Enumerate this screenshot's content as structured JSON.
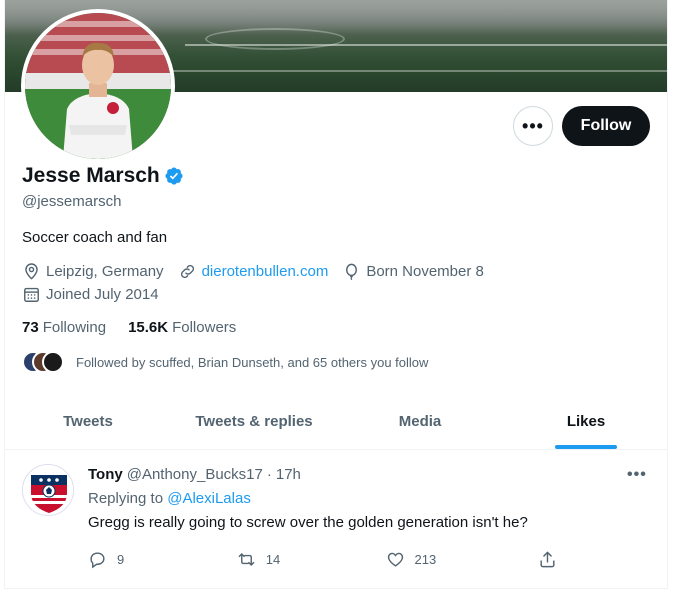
{
  "profile": {
    "name": "Jesse Marsch",
    "handle": "@jessemarsch",
    "bio": "Soccer coach and fan",
    "location": "Leipzig, Germany",
    "website": "dierotenbullen.com",
    "birthday": "Born November 8",
    "joined": "Joined July 2014",
    "following_count": "73",
    "following_label": "Following",
    "followers_count": "15.6K",
    "followers_label": "Followers",
    "followed_by": "Followed by scuffed, Brian Dunseth, and 65 others you follow"
  },
  "actions": {
    "more": "•••",
    "follow": "Follow"
  },
  "tabs": [
    {
      "label": "Tweets"
    },
    {
      "label": "Tweets & replies"
    },
    {
      "label": "Media"
    },
    {
      "label": "Likes"
    }
  ],
  "tweet": {
    "author": "Tony",
    "handle": "@Anthony_Bucks17",
    "separator": "·",
    "time": "17h",
    "replying_prefix": "Replying to",
    "replying_to": "@AlexiLalas",
    "text": "Gregg is really going to screw over the golden generation isn't he?",
    "more": "•••",
    "replies": "9",
    "retweets": "14",
    "likes": "213"
  },
  "colors": {
    "accent": "#1d9bf0",
    "text": "#0f1419",
    "secondary": "#536471",
    "follow_button": "#0f1419"
  },
  "icons": [
    "verified-badge-icon",
    "location-icon",
    "link-icon",
    "balloon-icon",
    "calendar-icon",
    "reply-icon",
    "retweet-icon",
    "like-icon",
    "share-icon"
  ]
}
